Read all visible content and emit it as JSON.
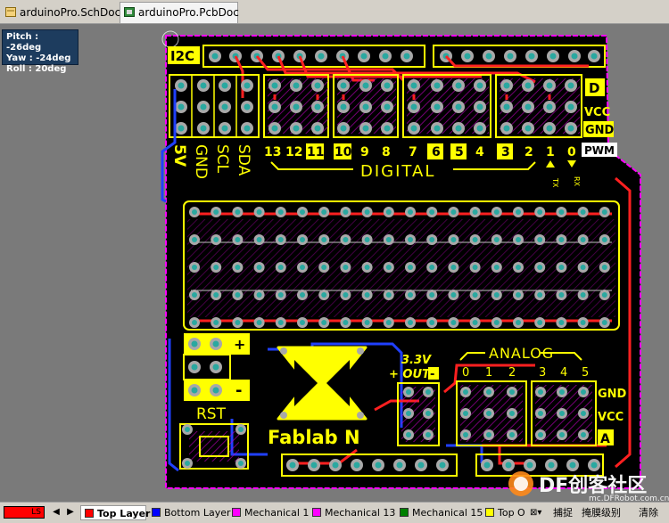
{
  "tabs": [
    {
      "label": "arduinoPro.SchDoc *",
      "icon": "schematic-doc-icon",
      "active": false
    },
    {
      "label": "arduinoPro.PcbDoc *",
      "icon": "pcb-doc-icon",
      "active": true
    }
  ],
  "hud": {
    "pitch": "Pitch : -26deg",
    "yaw": "Yaw : -24deg",
    "roll": "Roll : 20deg"
  },
  "pcb": {
    "i2c_label": "I2C",
    "pin_numbers": [
      "13",
      "12",
      "11",
      "10",
      "9",
      "8",
      "7",
      "6",
      "5",
      "4",
      "3",
      "2",
      "1",
      "0"
    ],
    "digital_label": "DIGITAL",
    "row_labels": [
      "D",
      "VCC",
      "GND",
      "PWM"
    ],
    "header_labels": [
      "5V",
      "GND",
      "SCL",
      "SDA"
    ],
    "tx_label": "TX",
    "rx_label": "RX",
    "plus": "+",
    "minus": "-",
    "rst": "RST",
    "fablab": "Fablab N",
    "v33": "3.3V",
    "out": "+ OUT",
    "out_minus": "-",
    "analog_label": "ANALOG",
    "analog_pins": [
      "0",
      "1",
      "2",
      "3",
      "4",
      "5"
    ],
    "analog_rows": [
      "GND",
      "VCC",
      "A"
    ],
    "colors": {
      "board": "#000000",
      "silk": "#ffff00",
      "trace_red": "#ff2020",
      "trace_blue": "#2040ff",
      "outline": "#ff00ff",
      "pad": "#b0b0b0",
      "hole": "#2aa8a0",
      "background": "#7a7a7a"
    }
  },
  "watermark": {
    "text": "DF创客社区",
    "url": "mc.DFRobot.com.cn"
  },
  "layer_bar": {
    "current": "LS",
    "layers": [
      {
        "label": "Top Layer",
        "color": "#ff0000",
        "active": true
      },
      {
        "label": "Bottom Layer",
        "color": "#0000ff",
        "active": false
      },
      {
        "label": "Mechanical 1",
        "color": "#ff00ff",
        "active": false
      },
      {
        "label": "Mechanical 13",
        "color": "#ff00ff",
        "active": false
      },
      {
        "label": "Mechanical 15",
        "color": "#008000",
        "active": false
      },
      {
        "label": "Top O",
        "color": "#ffff00",
        "active": false
      }
    ],
    "tools": [
      "捕捉",
      "掩膜级别",
      "清除"
    ]
  }
}
